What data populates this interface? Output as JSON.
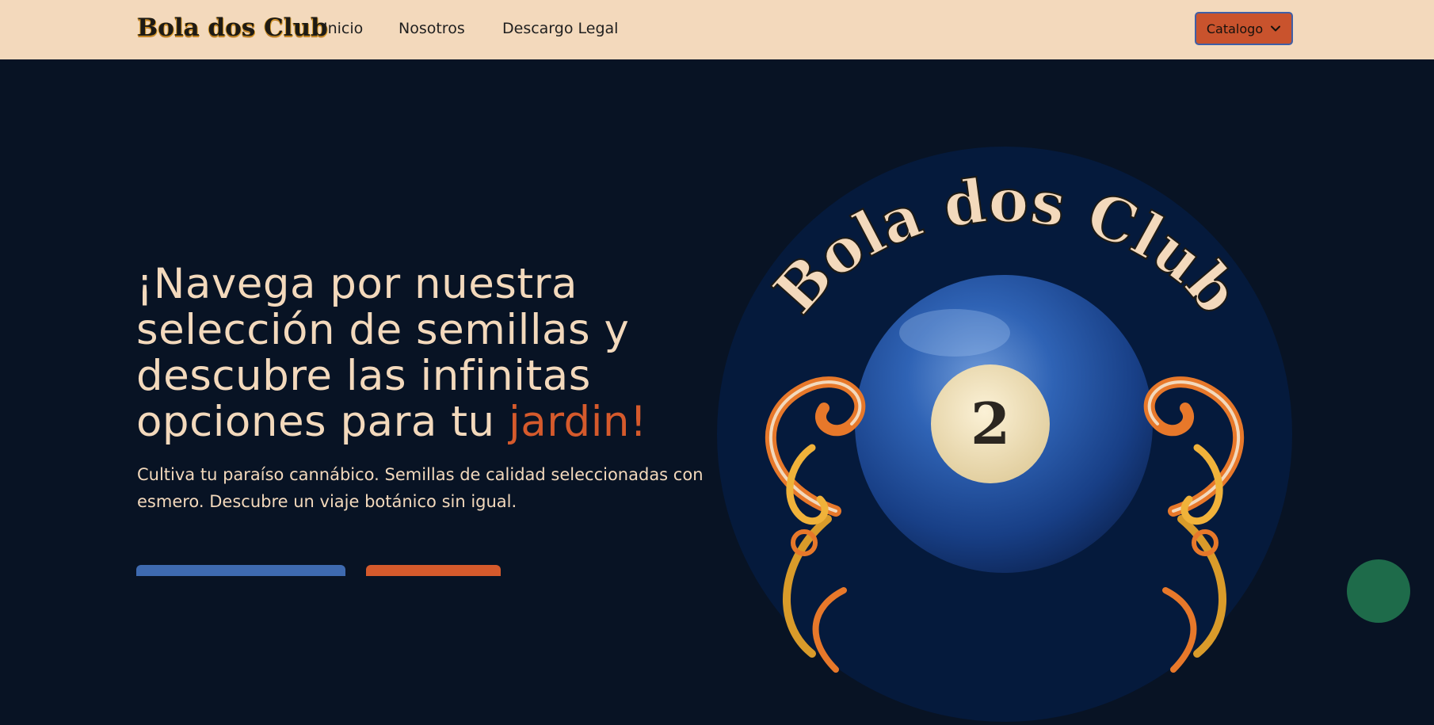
{
  "navbar": {
    "brand": "Bola dos Club",
    "links": [
      "Inicio",
      "Nosotros",
      "Descargo Legal"
    ],
    "catalog_button": "Catalogo"
  },
  "hero": {
    "title_main": "¡Navega por nuestra selección de semillas y descubre las infinitas opciones para tu ",
    "title_accent": "jardin!",
    "subtitle": "Cultiva tu paraíso cannábico. Semillas de calidad seleccionadas con esmero. Descubre un viaje botánico sin igual."
  },
  "logo": {
    "text": "Bola dos Club",
    "ball_number": "2"
  },
  "colors": {
    "navbar_bg": "#f3d9bc",
    "page_bg": "#081324",
    "accent": "#d55a2c",
    "button_blue": "#3e6ab0",
    "cream_text": "#f3d9bc"
  }
}
